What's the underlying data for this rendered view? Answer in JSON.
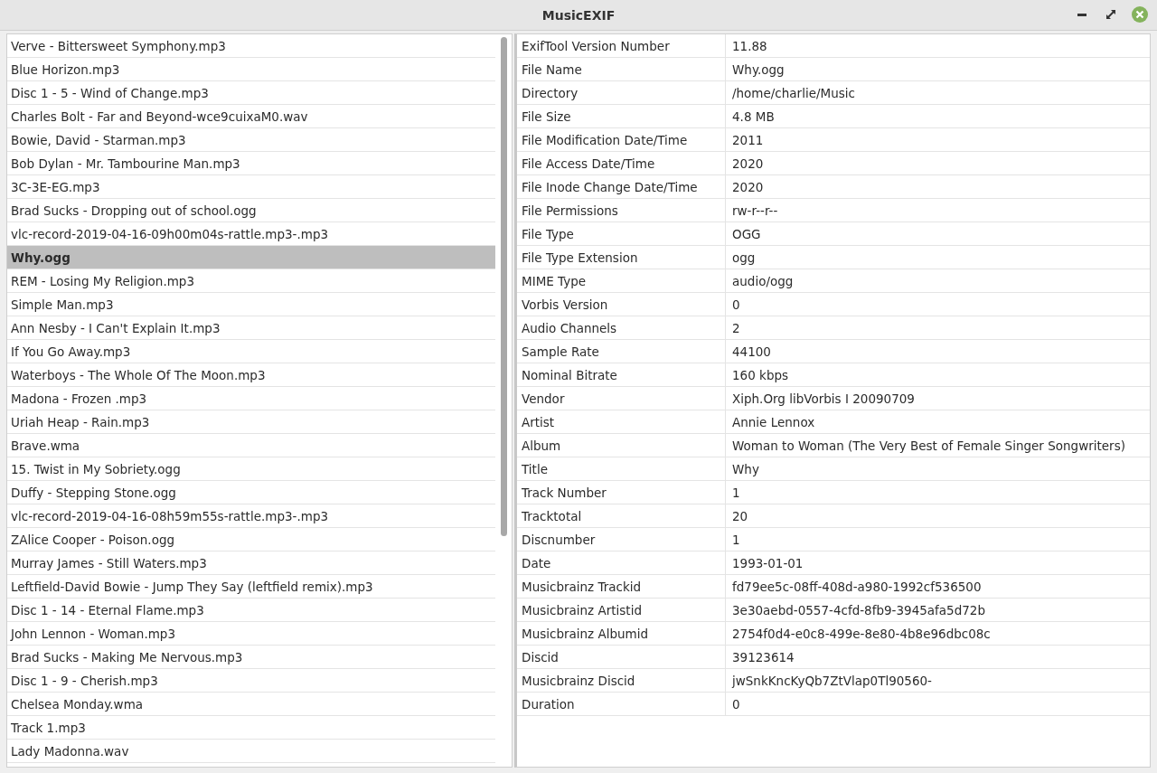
{
  "window": {
    "title": "MusicEXIF"
  },
  "files": [
    {
      "name": "Verve - Bittersweet Symphony.mp3",
      "selected": false
    },
    {
      "name": "Blue Horizon.mp3",
      "selected": false
    },
    {
      "name": "Disc 1 - 5 - Wind of Change.mp3",
      "selected": false
    },
    {
      "name": "Charles Bolt - Far and Beyond-wce9cuixaM0.wav",
      "selected": false
    },
    {
      "name": "Bowie, David - Starman.mp3",
      "selected": false
    },
    {
      "name": "Bob Dylan - Mr. Tambourine Man.mp3",
      "selected": false
    },
    {
      "name": "3C-3E-EG.mp3",
      "selected": false
    },
    {
      "name": "Brad Sucks - Dropping out of school.ogg",
      "selected": false
    },
    {
      "name": "vlc-record-2019-04-16-09h00m04s-rattle.mp3-.mp3",
      "selected": false
    },
    {
      "name": "Why.ogg",
      "selected": true
    },
    {
      "name": "REM - Losing My Religion.mp3",
      "selected": false
    },
    {
      "name": "Simple Man.mp3",
      "selected": false
    },
    {
      "name": "Ann Nesby - I Can't Explain It.mp3",
      "selected": false
    },
    {
      "name": "If You Go Away.mp3",
      "selected": false
    },
    {
      "name": "Waterboys - The Whole Of The Moon.mp3",
      "selected": false
    },
    {
      "name": "Madona - Frozen .mp3",
      "selected": false
    },
    {
      "name": "Uriah Heap - Rain.mp3",
      "selected": false
    },
    {
      "name": "Brave.wma",
      "selected": false
    },
    {
      "name": "15. Twist in My Sobriety.ogg",
      "selected": false
    },
    {
      "name": "Duffy - Stepping Stone.ogg",
      "selected": false
    },
    {
      "name": "vlc-record-2019-04-16-08h59m55s-rattle.mp3-.mp3",
      "selected": false
    },
    {
      "name": "ZAlice Cooper - Poison.ogg",
      "selected": false
    },
    {
      "name": "Murray James - Still Waters.mp3",
      "selected": false
    },
    {
      "name": "Leftfield-David Bowie - Jump They Say (leftfield remix).mp3",
      "selected": false
    },
    {
      "name": "Disc 1 - 14 - Eternal Flame.mp3",
      "selected": false
    },
    {
      "name": "John Lennon - Woman.mp3",
      "selected": false
    },
    {
      "name": "Brad Sucks - Making Me Nervous.mp3",
      "selected": false
    },
    {
      "name": "Disc 1 - 9 - Cherish.mp3",
      "selected": false
    },
    {
      "name": "Chelsea Monday.wma",
      "selected": false
    },
    {
      "name": "Track 1.mp3",
      "selected": false
    },
    {
      "name": "Lady Madonna.wav",
      "selected": false
    }
  ],
  "tags": [
    {
      "tag": "ExifTool Version Number",
      "value": "11.88"
    },
    {
      "tag": "File Name",
      "value": "Why.ogg"
    },
    {
      "tag": "Directory",
      "value": "/home/charlie/Music"
    },
    {
      "tag": "File Size",
      "value": "4.8 MB"
    },
    {
      "tag": "File Modification Date/Time",
      "value": "2011"
    },
    {
      "tag": "File Access Date/Time",
      "value": "2020"
    },
    {
      "tag": "File Inode Change Date/Time",
      "value": "2020"
    },
    {
      "tag": "File Permissions",
      "value": "rw-r--r--"
    },
    {
      "tag": "File Type",
      "value": "OGG"
    },
    {
      "tag": "File Type Extension",
      "value": "ogg"
    },
    {
      "tag": "MIME Type",
      "value": "audio/ogg"
    },
    {
      "tag": "Vorbis Version",
      "value": "0"
    },
    {
      "tag": "Audio Channels",
      "value": "2"
    },
    {
      "tag": "Sample Rate",
      "value": "44100"
    },
    {
      "tag": "Nominal Bitrate",
      "value": "160 kbps"
    },
    {
      "tag": "Vendor",
      "value": "Xiph.Org libVorbis I 20090709"
    },
    {
      "tag": "Artist",
      "value": "Annie Lennox"
    },
    {
      "tag": "Album",
      "value": "Woman to Woman (The Very Best of Female Singer Songwriters)"
    },
    {
      "tag": "Title",
      "value": "Why"
    },
    {
      "tag": "Track Number",
      "value": "1"
    },
    {
      "tag": "Tracktotal",
      "value": "20"
    },
    {
      "tag": "Discnumber",
      "value": "1"
    },
    {
      "tag": "Date",
      "value": "1993-01-01"
    },
    {
      "tag": "Musicbrainz Trackid",
      "value": "fd79ee5c-08ff-408d-a980-1992cf536500"
    },
    {
      "tag": "Musicbrainz Artistid",
      "value": "3e30aebd-0557-4cfd-8fb9-3945afa5d72b"
    },
    {
      "tag": "Musicbrainz Albumid",
      "value": "2754f0d4-e0c8-499e-8e80-4b8e96dbc08c"
    },
    {
      "tag": "Discid",
      "value": "39123614"
    },
    {
      "tag": "Musicbrainz Discid",
      "value": "jwSnkKncKyQb7ZtVlap0Tl90560-"
    },
    {
      "tag": "Duration",
      "value": "0"
    }
  ]
}
